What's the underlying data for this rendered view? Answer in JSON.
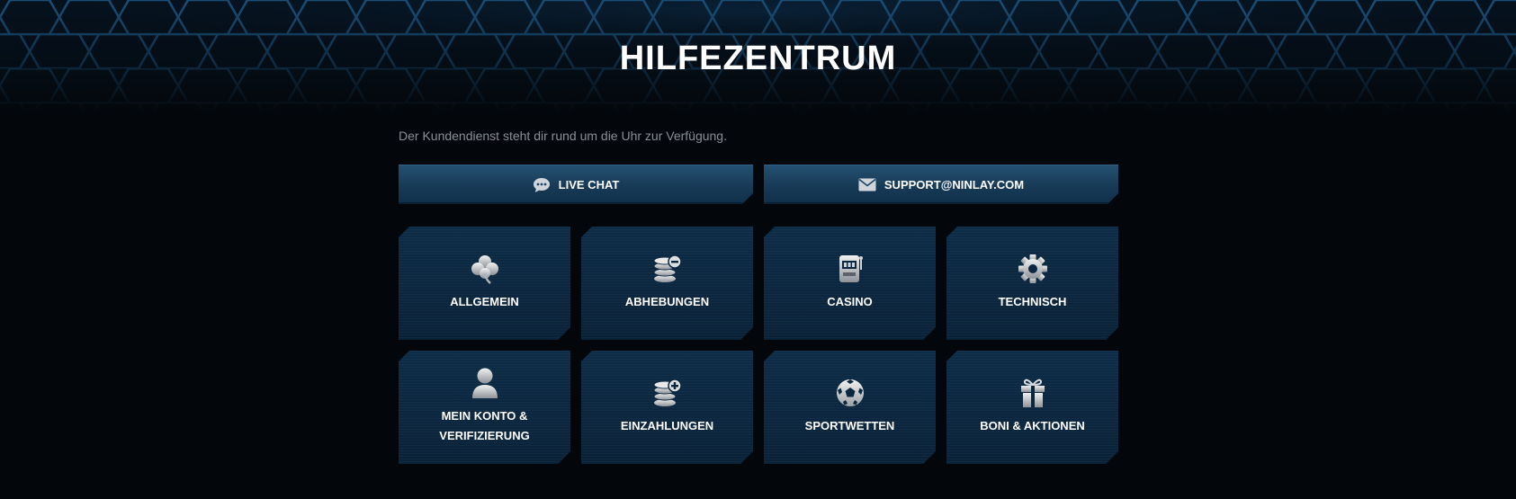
{
  "page": {
    "title": "HILFEZENTRUM",
    "intro": "Der Kundendienst steht dir rund um die Uhr zur Verfügung."
  },
  "contact": {
    "live_chat": {
      "label": "LIVE CHAT",
      "icon": "chat-bubble-icon"
    },
    "email": {
      "label": "SUPPORT@NINLAY.COM",
      "icon": "envelope-icon"
    }
  },
  "categories": [
    {
      "label": "ALLGEMEIN",
      "icon": "clover-icon"
    },
    {
      "label": "ABHEBUNGEN",
      "icon": "coins-minus-icon"
    },
    {
      "label": "CASINO",
      "icon": "slot-machine-icon"
    },
    {
      "label": "TECHNISCH",
      "icon": "gear-icon"
    },
    {
      "label_line1": "MEIN KONTO &",
      "label_line2": "VERIFIZIERUNG",
      "icon": "user-icon"
    },
    {
      "label": "EINZAHLUNGEN",
      "icon": "coins-plus-icon"
    },
    {
      "label": "SPORTWETTEN",
      "icon": "soccer-ball-icon"
    },
    {
      "label": "BONI & AKTIONEN",
      "icon": "gift-icon"
    }
  ],
  "colors": {
    "background": "#03070c",
    "tile": "#0b2740",
    "button": "#1c4566",
    "text": "#ffffff",
    "muted_text": "#8a8f96"
  }
}
